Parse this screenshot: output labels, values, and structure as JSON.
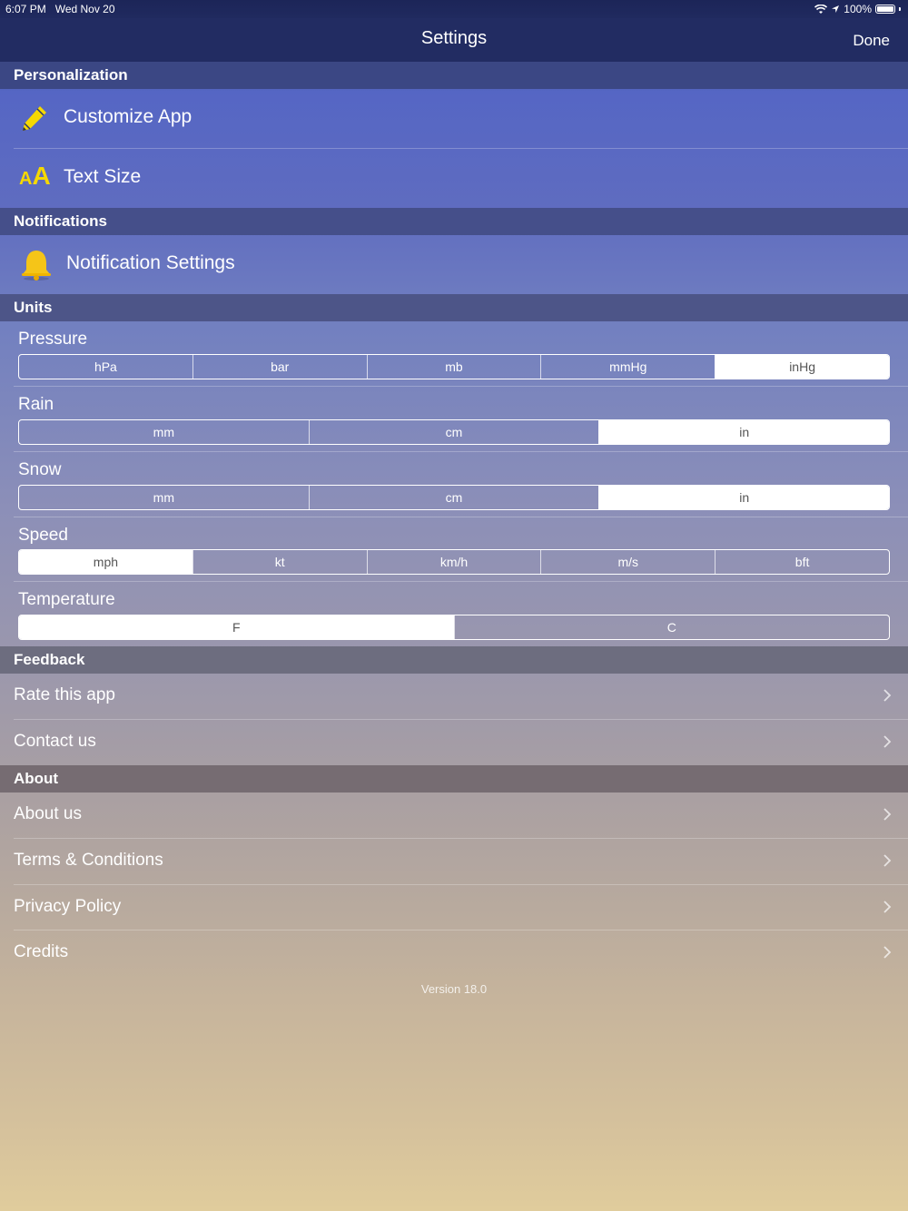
{
  "status_bar": {
    "time": "6:07 PM",
    "date": "Wed Nov 20",
    "battery": "100%"
  },
  "nav": {
    "title": "Settings",
    "done_label": "Done"
  },
  "sections": {
    "personalization": "Personalization",
    "notifications": "Notifications",
    "units": "Units",
    "feedback": "Feedback",
    "about": "About"
  },
  "personalization": {
    "customize_app": "Customize App",
    "text_size": "Text Size",
    "text_size_icon": "AA"
  },
  "notifications": {
    "settings": "Notification Settings"
  },
  "units": {
    "pressure": {
      "label": "Pressure",
      "options": [
        "hPa",
        "bar",
        "mb",
        "mmHg",
        "inHg"
      ],
      "selected": "inHg"
    },
    "rain": {
      "label": "Rain",
      "options": [
        "mm",
        "cm",
        "in"
      ],
      "selected": "in"
    },
    "snow": {
      "label": "Snow",
      "options": [
        "mm",
        "cm",
        "in"
      ],
      "selected": "in"
    },
    "speed": {
      "label": "Speed",
      "options": [
        "mph",
        "kt",
        "km/h",
        "m/s",
        "bft"
      ],
      "selected": "mph"
    },
    "temperature": {
      "label": "Temperature",
      "options": [
        "F",
        "C"
      ],
      "selected": "F"
    }
  },
  "feedback": {
    "rate": "Rate this app",
    "contact": "Contact us"
  },
  "about": {
    "about_us": "About us",
    "terms": "Terms & Conditions",
    "privacy": "Privacy Policy",
    "credits": "Credits"
  },
  "version": "Version  18.0",
  "colors": {
    "icon_yellow": "#f5d800",
    "nav_bg": "#222c62"
  }
}
